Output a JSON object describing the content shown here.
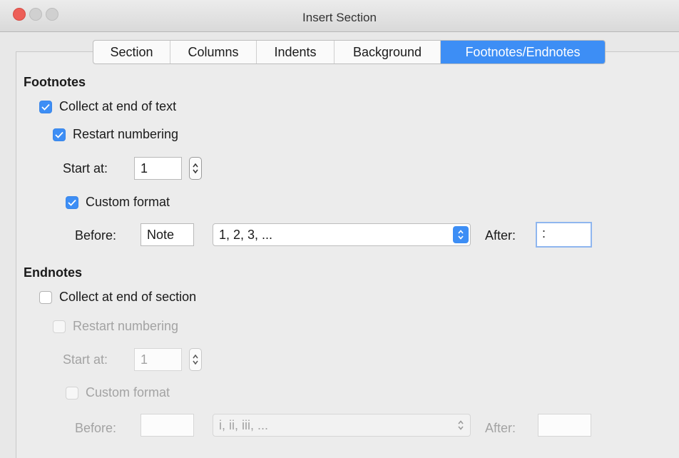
{
  "window": {
    "title": "Insert Section"
  },
  "tabs": [
    {
      "label": "Section"
    },
    {
      "label": "Columns"
    },
    {
      "label": "Indents"
    },
    {
      "label": "Background"
    },
    {
      "label": "Footnotes/Endnotes",
      "active": true
    }
  ],
  "footnotes": {
    "heading": "Footnotes",
    "collect": {
      "label": "Collect at end of text",
      "checked": true
    },
    "restart": {
      "label": "Restart numbering",
      "checked": true
    },
    "start_at": {
      "label": "Start at:",
      "value": "1"
    },
    "custom_format": {
      "label": "Custom format",
      "checked": true
    },
    "before": {
      "label": "Before:",
      "value": "Note"
    },
    "format": {
      "value": "1, 2, 3, ..."
    },
    "after": {
      "label": "After:",
      "value": ":"
    }
  },
  "endnotes": {
    "heading": "Endnotes",
    "collect": {
      "label": "Collect at end of section",
      "checked": false
    },
    "restart": {
      "label": "Restart numbering",
      "checked": false
    },
    "start_at": {
      "label": "Start at:",
      "value": "1"
    },
    "custom_format": {
      "label": "Custom format",
      "checked": false
    },
    "before": {
      "label": "Before:",
      "value": ""
    },
    "format": {
      "value": "i, ii, iii, ..."
    },
    "after": {
      "label": "After:",
      "value": ""
    }
  },
  "colors": {
    "accent": "#3d8ef5",
    "disabled_text": "#a3a3a3"
  }
}
